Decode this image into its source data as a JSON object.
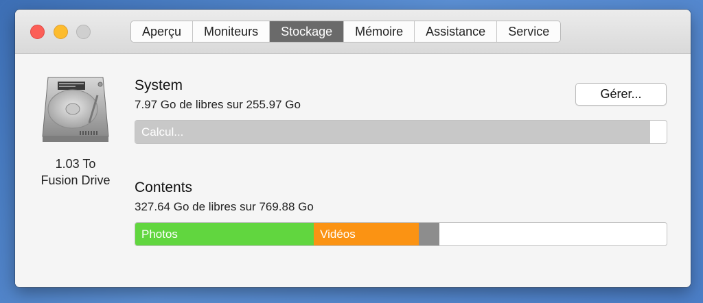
{
  "window": {
    "tabs": [
      {
        "label": "Aperçu",
        "active": false
      },
      {
        "label": "Moniteurs",
        "active": false
      },
      {
        "label": "Stockage",
        "active": true
      },
      {
        "label": "Mémoire",
        "active": false
      },
      {
        "label": "Assistance",
        "active": false
      },
      {
        "label": "Service",
        "active": false
      }
    ]
  },
  "disk": {
    "icon": "hard-drive-icon",
    "size_line": "1.03 To",
    "name_line": "Fusion Drive"
  },
  "manage_button": {
    "label": "Gérer..."
  },
  "volumes": [
    {
      "title": "System",
      "subtitle": "7.97 Go de libres sur 255.97 Go",
      "status_text": "Calcul...",
      "calculating_fraction": 0.969,
      "calculating_color": "#c8c8c8"
    },
    {
      "title": "Contents",
      "subtitle": "327.64 Go de libres sur 769.88 Go",
      "segments": [
        {
          "label": "Photos",
          "color": "#61d63f",
          "fraction": 0.336
        },
        {
          "label": "Vidéos",
          "color": "#fb9313",
          "fraction": 0.197
        },
        {
          "label": "",
          "color": "#8d8d8d",
          "fraction": 0.04
        }
      ]
    }
  ],
  "colors": {
    "tab_active": "#6a6a6a",
    "photos": "#61d63f",
    "videos": "#fb9313",
    "other": "#8d8d8d"
  }
}
